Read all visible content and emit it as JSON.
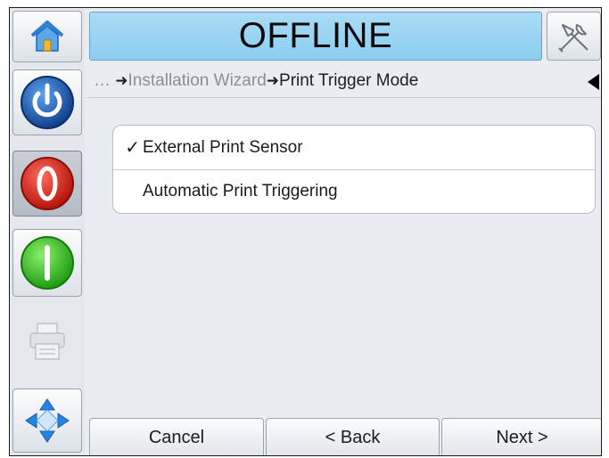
{
  "header": {
    "status_text": "OFFLINE",
    "status_color": "#9ad5f3"
  },
  "sidebar": {
    "items": [
      {
        "icon": "home-icon"
      },
      {
        "icon": "power-icon",
        "color": "#1c5fb8"
      },
      {
        "icon": "stop-icon",
        "color": "#e0261d"
      },
      {
        "icon": "start-icon",
        "color": "#3fcf24"
      },
      {
        "icon": "printer-icon"
      },
      {
        "icon": "navigate-icon",
        "color": "#1f7fe0"
      }
    ],
    "tools_icon": "tools-icon"
  },
  "breadcrumb": {
    "prefix": "…",
    "parent": "Installation Wizard",
    "current": "Print Trigger Mode",
    "arrow": "➜"
  },
  "options": [
    {
      "label": "External Print Sensor",
      "selected": true,
      "check": "✓"
    },
    {
      "label": "Automatic Print Triggering",
      "selected": false,
      "check": ""
    }
  ],
  "footer": {
    "cancel_label": "Cancel",
    "back_label": "< Back",
    "next_label": "Next >"
  }
}
